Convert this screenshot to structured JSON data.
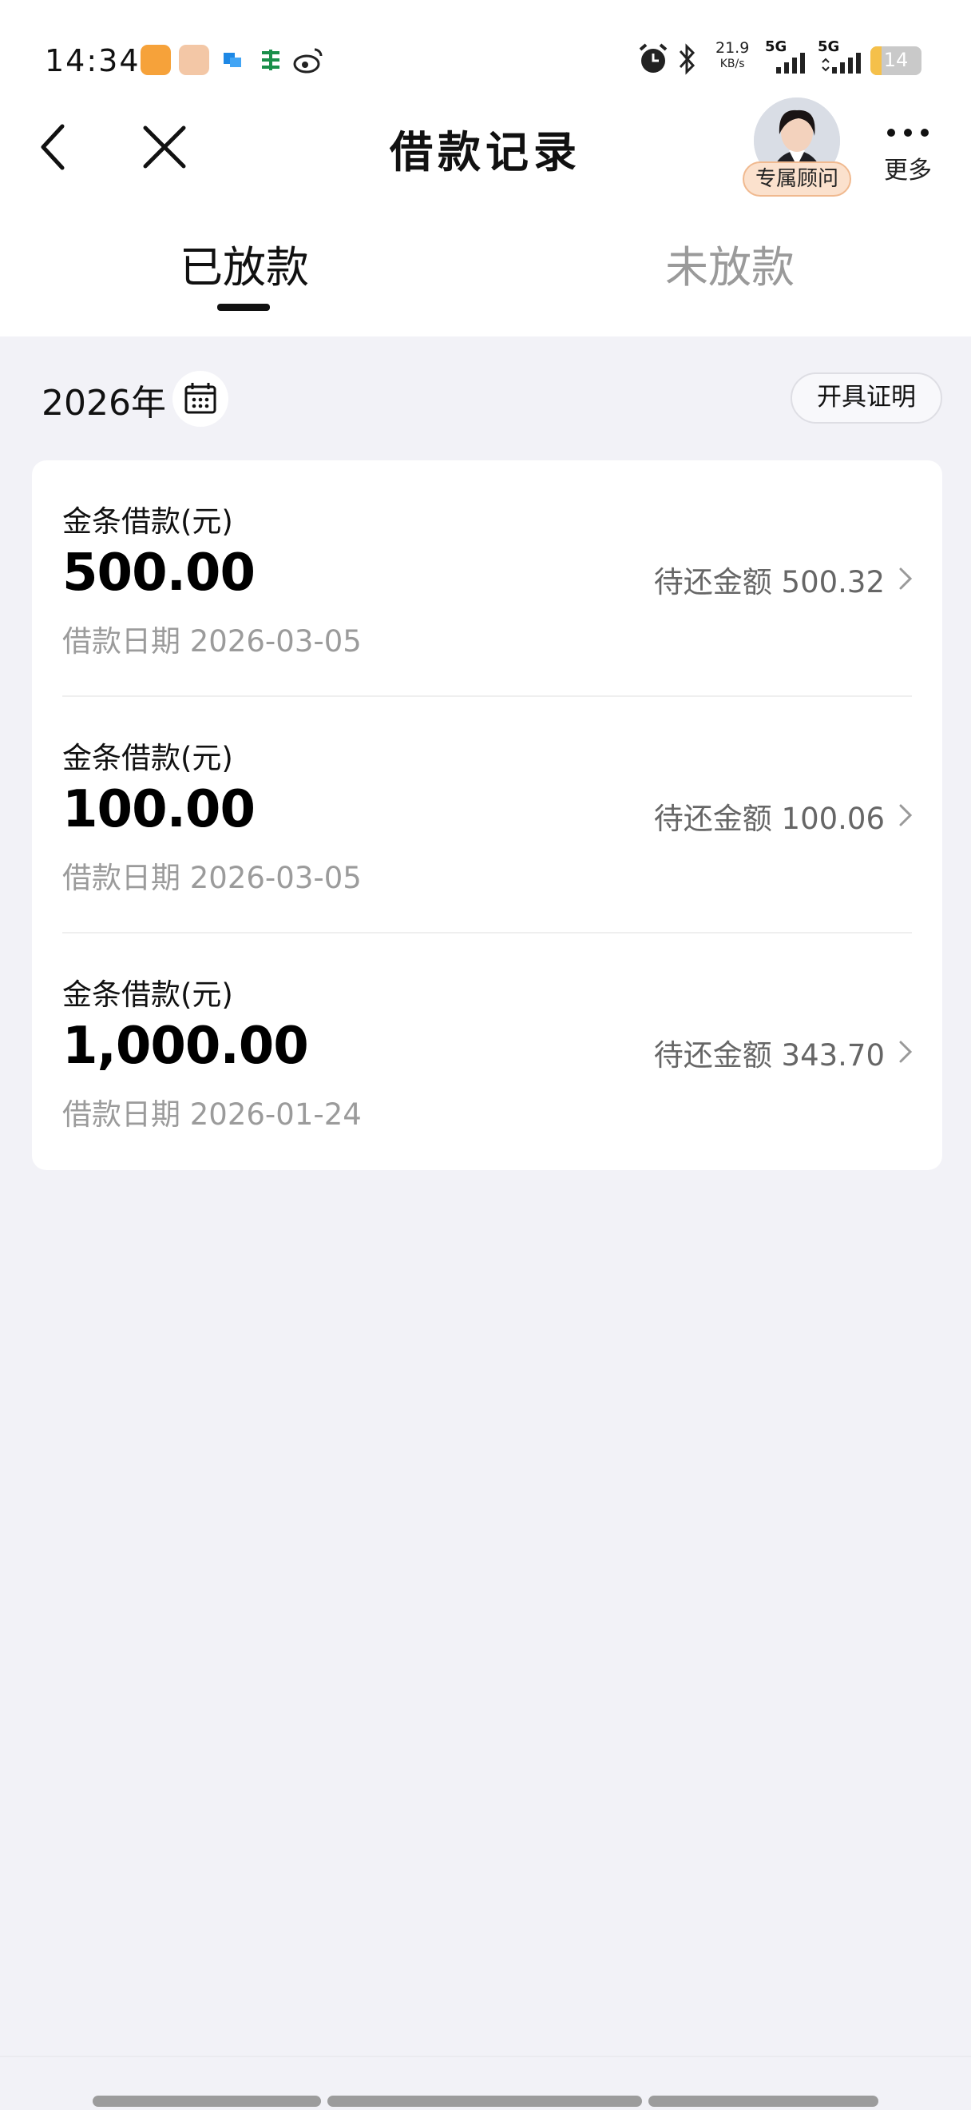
{
  "status_bar": {
    "time": "14:34",
    "net_speed_value": "21.9",
    "net_speed_unit": "KB/s",
    "network_1": "5G",
    "network_2": "5G",
    "battery": "14"
  },
  "nav": {
    "title": "借款记录",
    "advisor_label": "专属顾问",
    "more_label": "更多"
  },
  "tabs": {
    "active": "已放款",
    "inactive": "未放款"
  },
  "filter": {
    "year": "2026年",
    "certificate_button": "开具证明"
  },
  "loans": [
    {
      "title": "金条借款(元)",
      "amount": "500.00",
      "date": "借款日期 2026-03-05",
      "outstanding": "待还金额 500.32"
    },
    {
      "title": "金条借款(元)",
      "amount": "100.00",
      "date": "借款日期 2026-03-05",
      "outstanding": "待还金额 100.06"
    },
    {
      "title": "金条借款(元)",
      "amount": "1,000.00",
      "date": "借款日期 2026-01-24",
      "outstanding": "待还金额 343.70"
    }
  ],
  "colors": {
    "page_background": "#f2f2f7",
    "card_background": "#ffffff",
    "advisor_badge": "#fbe1cd",
    "battery_level": "#f5c04a"
  }
}
